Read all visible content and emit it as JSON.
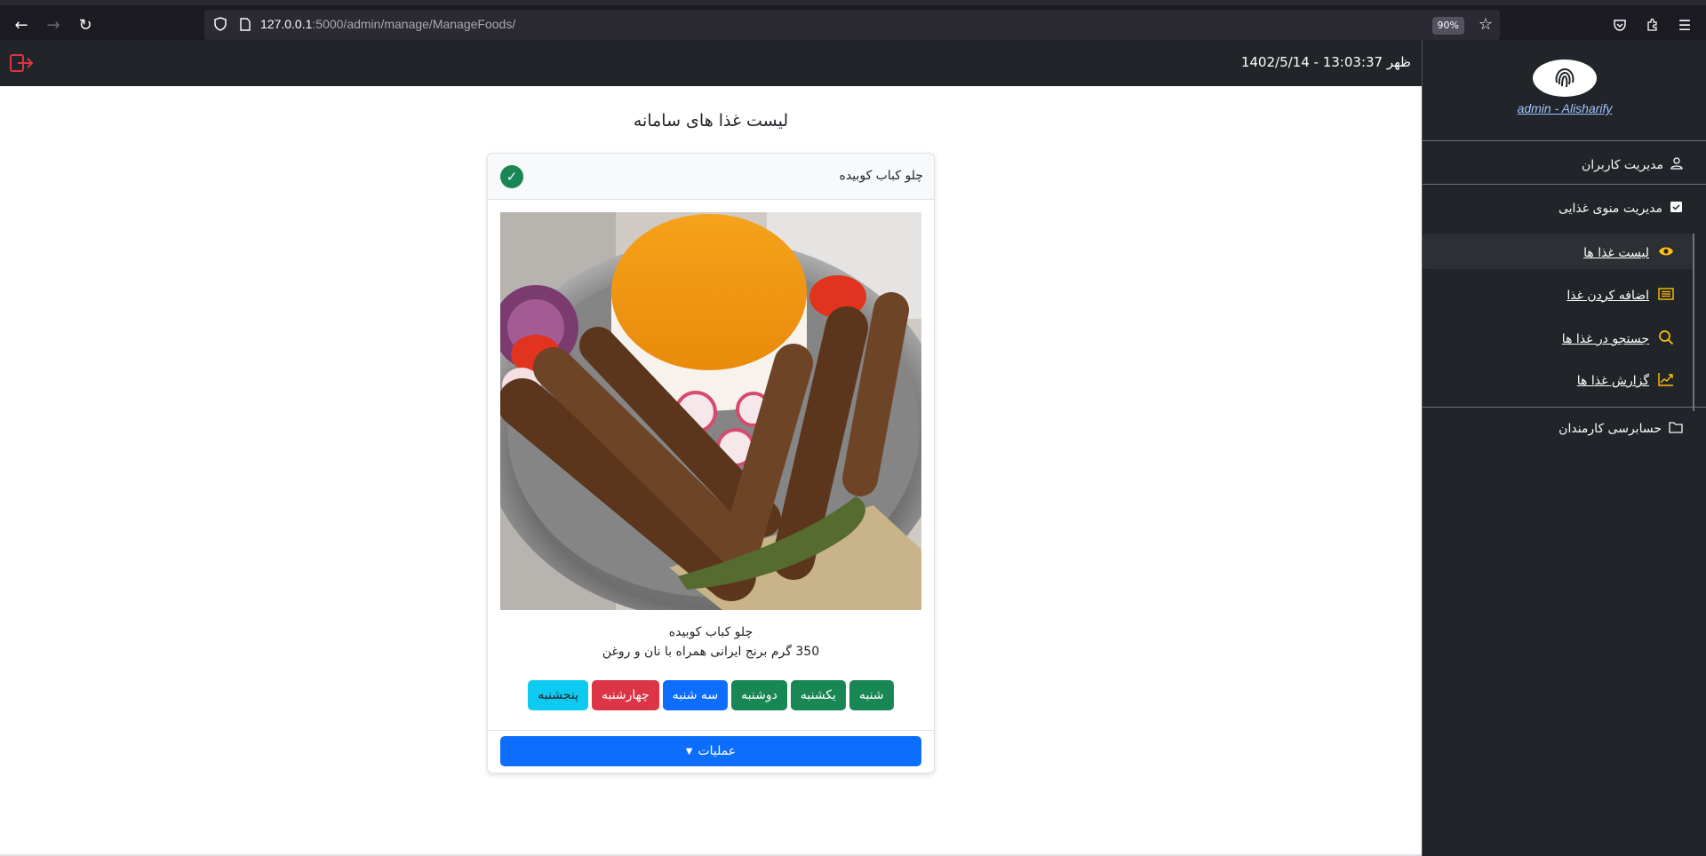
{
  "browser": {
    "url_host": "127.0.0.1",
    "url_path": ":5000/admin/manage/ManageFoods/",
    "zoom": "90%"
  },
  "header": {
    "datetime": "ظهر 13:03:37 - 1402/5/14"
  },
  "sidebar": {
    "admin_label": "admin - Alisharify",
    "items": [
      {
        "label": "مدیریت کاربران",
        "icon": "user-icon"
      },
      {
        "label": "مدیریت منوی غذایی",
        "icon": "calendar-check-icon"
      },
      {
        "label": "حسابرسی کارمندان",
        "icon": "folder-icon"
      }
    ],
    "submenu": [
      {
        "label": "لیست غذا ها",
        "icon": "eye-icon",
        "active": true
      },
      {
        "label": "اضافه کردن غذا",
        "icon": "list-icon"
      },
      {
        "label": "جستجو در غذا ها",
        "icon": "search-icon"
      },
      {
        "label": "گزارش غذا ها",
        "icon": "graph-icon"
      }
    ]
  },
  "main": {
    "title": "لیست غذا های سامانه",
    "card": {
      "header_title": "چلو کباب کوبیده",
      "food_name": "چلو کباب کوبیده",
      "food_desc": "350 گرم برنج ایرانی همراه با نان و روغن",
      "days": [
        {
          "label": "شنبه",
          "color": "#198754"
        },
        {
          "label": "یکشنبه",
          "color": "#198754"
        },
        {
          "label": "دوشنبه",
          "color": "#198754"
        },
        {
          "label": "سه شنبه",
          "color": "#0d6efd"
        },
        {
          "label": "چهارشنبه",
          "color": "#dc3545"
        },
        {
          "label": "پنجشنبه",
          "color": "#0dcaf0"
        }
      ],
      "operations_label": "عملیات"
    }
  },
  "colors": {
    "sidebar_bg": "#212529",
    "accent_yellow": "#ffc107",
    "primary": "#0d6efd",
    "success": "#198754",
    "danger": "#dc3545",
    "info": "#0dcaf0"
  }
}
